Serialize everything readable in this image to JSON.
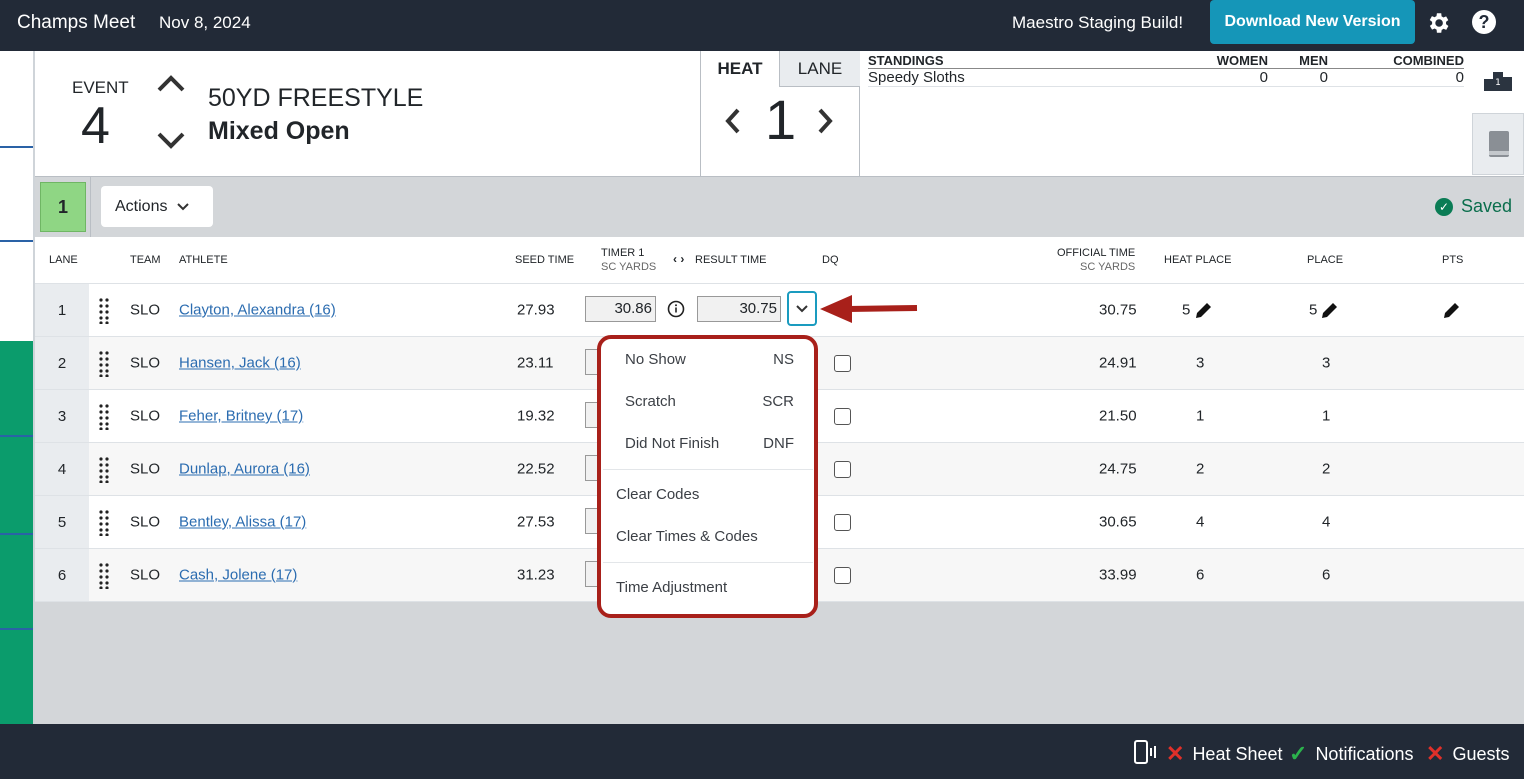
{
  "topbar": {
    "meet_name": "Champs Meet",
    "meet_date": "Nov 8, 2024",
    "build_label": "Maestro Staging Build!",
    "download_label": "Download New Version",
    "settings_icon": "gear-icon",
    "help_icon": "question-circle-icon"
  },
  "event": {
    "label": "EVENT",
    "number": "4",
    "title": "50YD FREESTYLE",
    "subtitle": "Mixed Open"
  },
  "heat": {
    "tab_heat": "HEAT",
    "tab_lane": "LANE",
    "number": "1"
  },
  "standings": {
    "title": "STANDINGS",
    "col_women": "WOMEN",
    "col_men": "MEN",
    "col_combined": "COMBINED",
    "rows": [
      {
        "team": "Speedy Sloths",
        "women": "0",
        "men": "0",
        "combined": "0"
      }
    ]
  },
  "toolbar": {
    "heat_chip": "1",
    "actions_label": "Actions",
    "saved_label": "Saved"
  },
  "table": {
    "headers": {
      "lane": "LANE",
      "team": "TEAM",
      "athlete": "ATHLETE",
      "seed": "SEED TIME",
      "timer1": "TIMER 1",
      "timer1_sub": "SC YARDS",
      "result": "RESULT TIME",
      "dq": "DQ",
      "official": "OFFICIAL TIME",
      "official_sub": "SC YARDS",
      "heat_place": "HEAT PLACE",
      "place": "PLACE",
      "pts": "PTS"
    },
    "rows": [
      {
        "lane": "1",
        "team": "SLO",
        "athlete": "Clayton, Alexandra (16)",
        "seed": "27.93",
        "timer1": "30.86",
        "result": "30.75",
        "official": "30.75",
        "heat_place": "5",
        "place": "5"
      },
      {
        "lane": "2",
        "team": "SLO",
        "athlete": "Hansen, Jack (16)",
        "seed": "23.11",
        "official": "24.91",
        "heat_place": "3",
        "place": "3"
      },
      {
        "lane": "3",
        "team": "SLO",
        "athlete": "Feher, Britney (17)",
        "seed": "19.32",
        "official": "21.50",
        "heat_place": "1",
        "place": "1"
      },
      {
        "lane": "4",
        "team": "SLO",
        "athlete": "Dunlap, Aurora (16)",
        "seed": "22.52",
        "official": "24.75",
        "heat_place": "2",
        "place": "2"
      },
      {
        "lane": "5",
        "team": "SLO",
        "athlete": "Bentley, Alissa (17)",
        "seed": "27.53",
        "official": "30.65",
        "heat_place": "4",
        "place": "4"
      },
      {
        "lane": "6",
        "team": "SLO",
        "athlete": "Cash, Jolene (17)",
        "seed": "31.23",
        "official": "33.99",
        "heat_place": "6",
        "place": "6"
      }
    ]
  },
  "dropdown": {
    "no_show": "No Show",
    "no_show_code": "NS",
    "scratch": "Scratch",
    "scratch_code": "SCR",
    "dnf": "Did Not Finish",
    "dnf_code": "DNF",
    "clear_codes": "Clear Codes",
    "clear_times": "Clear Times & Codes",
    "time_adjustment": "Time Adjustment"
  },
  "footer": {
    "heat_sheet": "Heat Sheet",
    "notifications": "Notifications",
    "guests": "Guests",
    "colors": {
      "error": "#e0302a",
      "ok": "#2bb24c"
    }
  }
}
